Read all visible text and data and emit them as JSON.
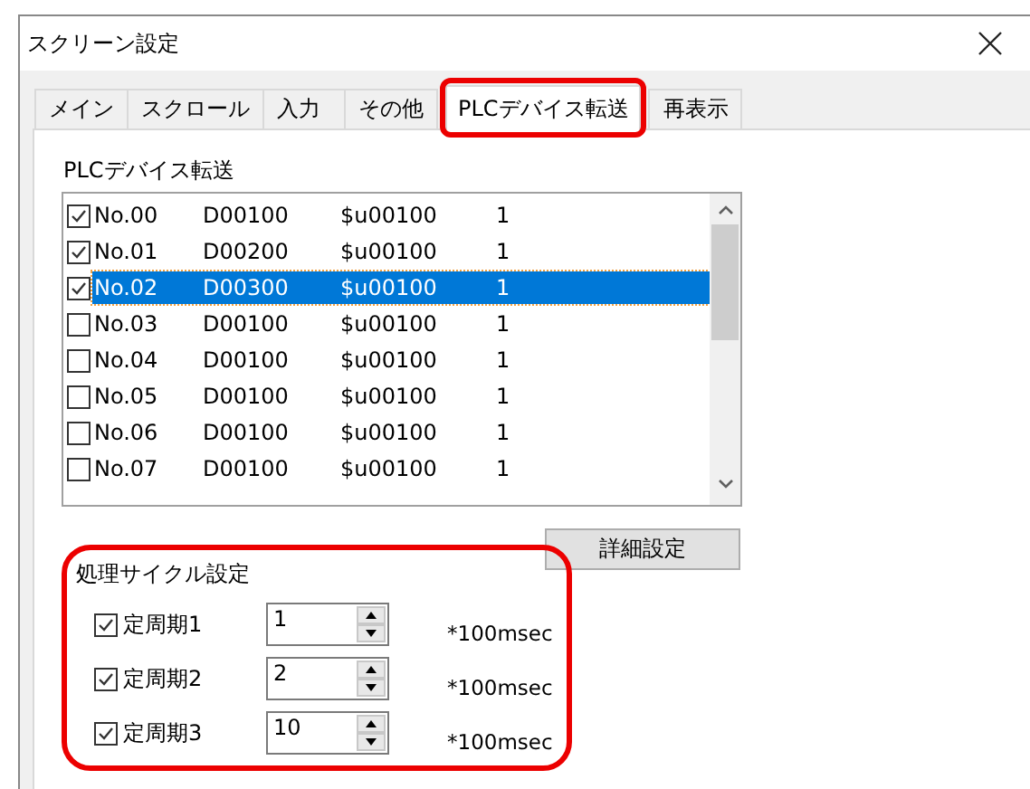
{
  "window": {
    "title": "スクリーン設定"
  },
  "tabs": [
    {
      "label": "メイン",
      "selected": false,
      "highlighted": false
    },
    {
      "label": "スクロール",
      "selected": false,
      "highlighted": false
    },
    {
      "label": "入力",
      "selected": false,
      "highlighted": false
    },
    {
      "label": "その他",
      "selected": false,
      "highlighted": false
    },
    {
      "label": "PLCデバイス転送",
      "selected": true,
      "highlighted": true
    },
    {
      "label": "再表示",
      "selected": false,
      "highlighted": false
    }
  ],
  "device_list": {
    "title": "PLCデバイス転送",
    "rows": [
      {
        "checked": true,
        "selected": false,
        "cells": [
          "No.00",
          "D00100",
          "$u00100",
          "1"
        ]
      },
      {
        "checked": true,
        "selected": false,
        "cells": [
          "No.01",
          "D00200",
          "$u00100",
          "1"
        ]
      },
      {
        "checked": true,
        "selected": true,
        "cells": [
          "No.02",
          "D00300",
          "$u00100",
          "1"
        ]
      },
      {
        "checked": false,
        "selected": false,
        "cells": [
          "No.03",
          "D00100",
          "$u00100",
          "1"
        ]
      },
      {
        "checked": false,
        "selected": false,
        "cells": [
          "No.04",
          "D00100",
          "$u00100",
          "1"
        ]
      },
      {
        "checked": false,
        "selected": false,
        "cells": [
          "No.05",
          "D00100",
          "$u00100",
          "1"
        ]
      },
      {
        "checked": false,
        "selected": false,
        "cells": [
          "No.06",
          "D00100",
          "$u00100",
          "1"
        ]
      },
      {
        "checked": false,
        "selected": false,
        "cells": [
          "No.07",
          "D00100",
          "$u00100",
          "1"
        ]
      }
    ]
  },
  "detail_button": "詳細設定",
  "cycle_group": {
    "title": "処理サイクル設定",
    "highlighted": true,
    "rows": [
      {
        "checked": true,
        "label": "定周期1",
        "value": "1",
        "unit": "*100msec"
      },
      {
        "checked": true,
        "label": "定周期2",
        "value": "2",
        "unit": "*100msec"
      },
      {
        "checked": true,
        "label": "定周期3",
        "value": "10",
        "unit": "*100msec"
      }
    ]
  }
}
